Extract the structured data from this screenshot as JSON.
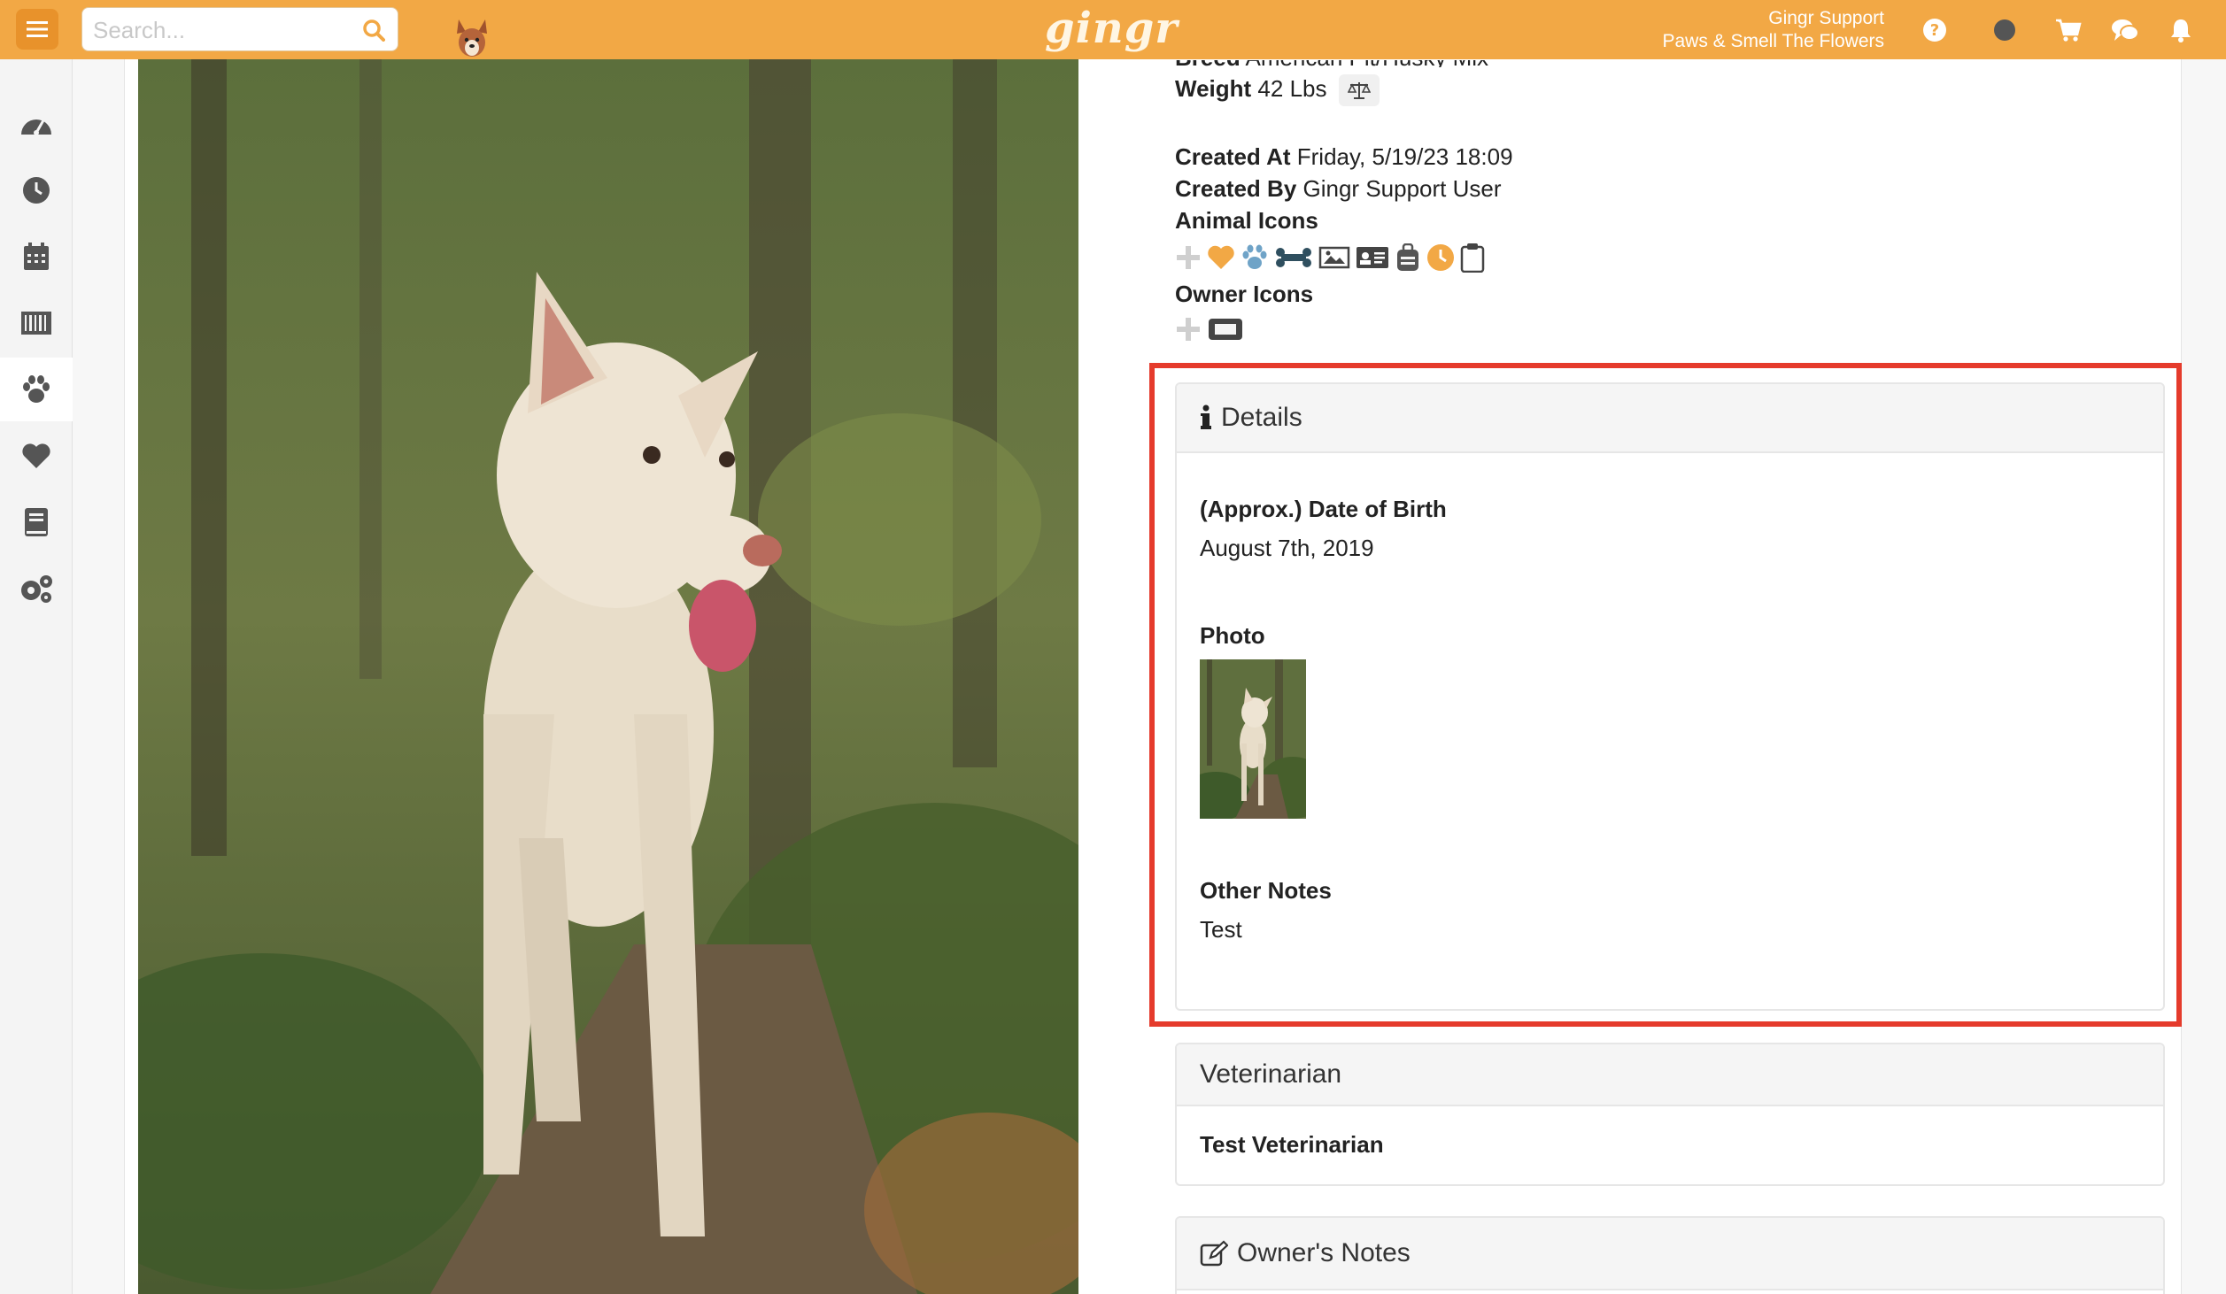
{
  "topbar": {
    "search_placeholder": "Search...",
    "logo": "gingr",
    "user_name": "Gingr Support",
    "business_name": "Paws & Smell The Flowers",
    "icons": [
      "menu-icon",
      "search-icon",
      "help-icon",
      "status-dot-icon",
      "cart-icon",
      "chat-icon",
      "bell-icon"
    ]
  },
  "sidebar": {
    "items": [
      {
        "name": "dashboard",
        "icon": "gauge-icon"
      },
      {
        "name": "history",
        "icon": "clock-icon"
      },
      {
        "name": "calendar",
        "icon": "calendar-icon"
      },
      {
        "name": "barcode",
        "icon": "barcode-icon"
      },
      {
        "name": "animals",
        "icon": "paw-icon",
        "active": true
      },
      {
        "name": "favorites",
        "icon": "heart-icon"
      },
      {
        "name": "reports",
        "icon": "book-icon"
      },
      {
        "name": "settings",
        "icon": "gears-icon"
      }
    ]
  },
  "animal": {
    "breed_label": "Breed",
    "breed_value": "American Pit/Husky Mix",
    "weight_label": "Weight",
    "weight_value": "42 Lbs",
    "created_at_label": "Created At",
    "created_at_value": "Friday, 5/19/23 18:09",
    "created_by_label": "Created By",
    "created_by_value": "Gingr Support User",
    "animal_icons_label": "Animal Icons",
    "owner_icons_label": "Owner Icons"
  },
  "details": {
    "title": "Details",
    "dob_label": "(Approx.) Date of Birth",
    "dob_value": "August 7th, 2019",
    "photo_label": "Photo",
    "notes_label": "Other Notes",
    "notes_value": "Test"
  },
  "veterinarian": {
    "title": "Veterinarian",
    "name": "Test Veterinarian"
  },
  "owners_notes": {
    "title": "Owner's Notes"
  },
  "colors": {
    "accent": "#f2a845",
    "highlight": "#e53b2c",
    "icon_gray": "#555555",
    "icon_blue": "#6fa3c7",
    "icon_orange": "#f2a845"
  }
}
